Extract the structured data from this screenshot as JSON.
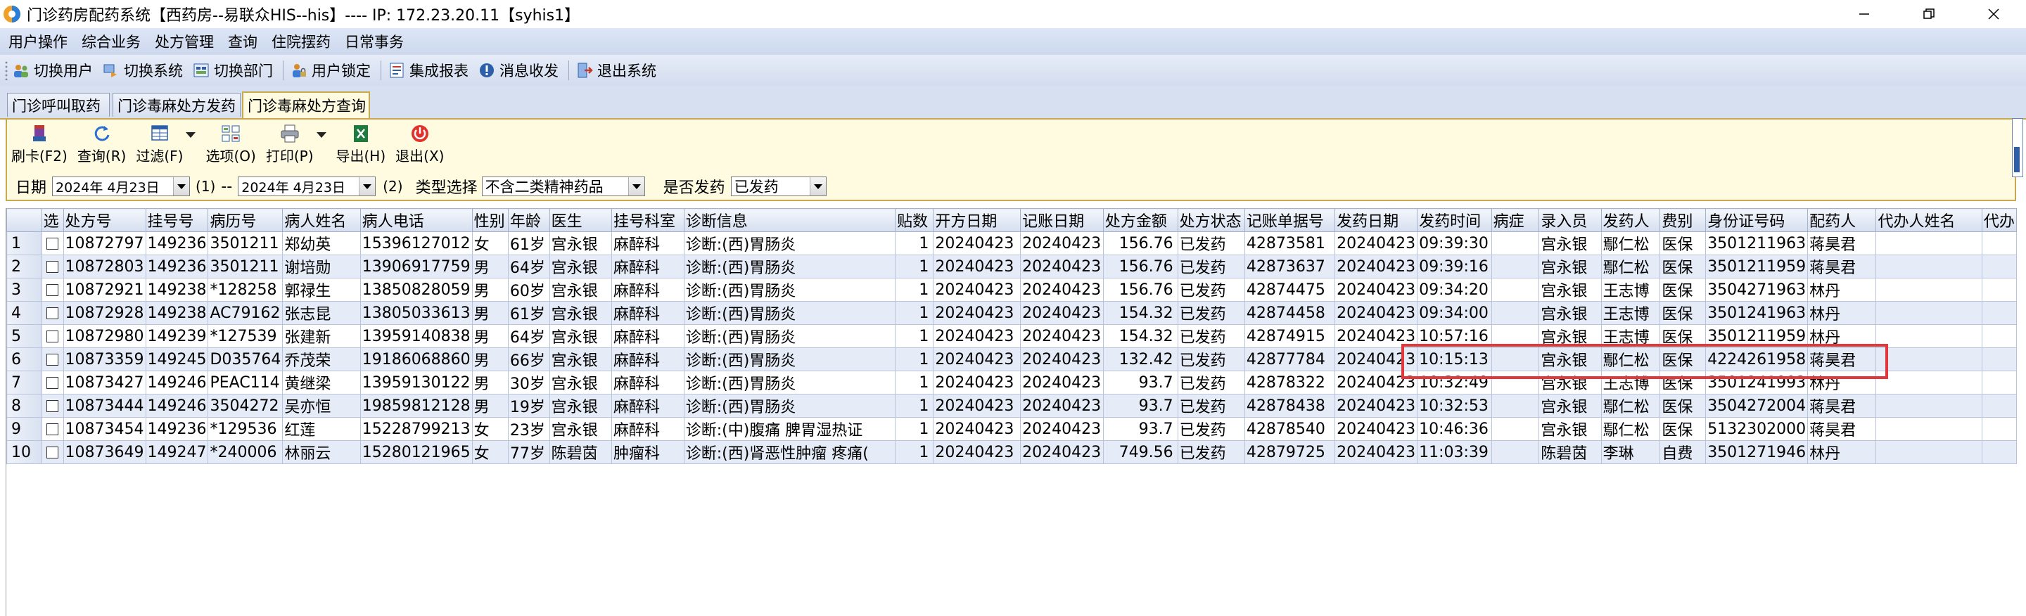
{
  "window": {
    "title": "门诊药房配药系统【西药房--易联众HIS--his】---- IP: 172.23.20.11【syhis1】"
  },
  "menu": [
    "用户操作",
    "综合业务",
    "处方管理",
    "查询",
    "住院摆药",
    "日常事务"
  ],
  "toolbar": {
    "items": [
      {
        "label": "切换用户",
        "icon": "users-icon"
      },
      {
        "label": "切换系统",
        "icon": "switch-system-icon"
      },
      {
        "label": "切换部门",
        "icon": "department-icon"
      },
      {
        "label": "用户锁定",
        "icon": "user-lock-icon"
      },
      {
        "label": "集成报表",
        "icon": "report-icon"
      },
      {
        "label": "消息收发",
        "icon": "message-icon"
      },
      {
        "label": "退出系统",
        "icon": "exit-icon"
      }
    ]
  },
  "tabs": [
    "门诊呼叫取药",
    "门诊毒麻处方发药",
    "门诊毒麻处方查询"
  ],
  "actions": {
    "card": "刷卡(F2)",
    "query": "查询(R)",
    "filter": "过滤(F)",
    "options": "选项(O)",
    "print": "打印(P)",
    "export": "导出(H)",
    "exit": "退出(X)"
  },
  "filter": {
    "date_label": "日期",
    "date_from": "2024年 4月23日",
    "marker1": "(1)",
    "dash": "--",
    "date_to": "2024年 4月23日",
    "marker2": "(2)",
    "type_label": "类型选择",
    "type_value": "不含二类精神药品",
    "dispensed_label": "是否发药",
    "dispensed_value": "已发药"
  },
  "grid": {
    "headers": [
      "",
      "选",
      "处方号",
      "挂号号",
      "病历号",
      "病人姓名",
      "病人电话",
      "性别",
      "年龄",
      "医生",
      "挂号科室",
      "诊断信息",
      "贴数",
      "开方日期",
      "记账日期",
      "处方金额",
      "处方状态",
      "记账单据号",
      "发药日期",
      "发药时间",
      "病症",
      "录入员",
      "发药人",
      "费别",
      "身份证号码",
      "配药人",
      "代办人姓名",
      "代办"
    ],
    "rows": [
      [
        "1",
        "",
        "10872797",
        "149236",
        "3501211",
        "郑幼英",
        "15396127012",
        "女",
        "61岁",
        "宫永银",
        "麻醉科",
        "诊断:(西)胃肠炎",
        "1",
        "20240423",
        "20240423",
        "156.76",
        "已发药",
        "42873581",
        "20240423",
        "09:39:30",
        "",
        "宫永银",
        "鄢仁松",
        "医保",
        "3501211963",
        "蒋昊君",
        "",
        ""
      ],
      [
        "2",
        "",
        "10872803",
        "149236",
        "3501211",
        "谢培勋",
        "13906917759",
        "男",
        "64岁",
        "宫永银",
        "麻醉科",
        "诊断:(西)胃肠炎",
        "1",
        "20240423",
        "20240423",
        "156.76",
        "已发药",
        "42873637",
        "20240423",
        "09:39:16",
        "",
        "宫永银",
        "鄢仁松",
        "医保",
        "3501211959",
        "蒋昊君",
        "",
        ""
      ],
      [
        "3",
        "",
        "10872921",
        "149238",
        "*128258",
        "郭禄生",
        "13850828059",
        "男",
        "60岁",
        "宫永银",
        "麻醉科",
        "诊断:(西)胃肠炎",
        "1",
        "20240423",
        "20240423",
        "156.76",
        "已发药",
        "42874475",
        "20240423",
        "09:34:20",
        "",
        "宫永银",
        "王志博",
        "医保",
        "3504271963",
        "林丹",
        "",
        ""
      ],
      [
        "4",
        "",
        "10872928",
        "149238",
        "AC79162",
        "张志昆",
        "13805033613",
        "男",
        "61岁",
        "宫永银",
        "麻醉科",
        "诊断:(西)胃肠炎",
        "1",
        "20240423",
        "20240423",
        "154.32",
        "已发药",
        "42874458",
        "20240423",
        "09:34:00",
        "",
        "宫永银",
        "王志博",
        "医保",
        "3501241963",
        "林丹",
        "",
        ""
      ],
      [
        "5",
        "",
        "10872980",
        "149239",
        "*127539",
        "张建新",
        "13959140838",
        "男",
        "64岁",
        "宫永银",
        "麻醉科",
        "诊断:(西)胃肠炎",
        "1",
        "20240423",
        "20240423",
        "154.32",
        "已发药",
        "42874915",
        "20240423",
        "10:57:16",
        "",
        "宫永银",
        "王志博",
        "医保",
        "3501211959",
        "林丹",
        "",
        ""
      ],
      [
        "6",
        "",
        "10873359",
        "149245",
        "D035764",
        "乔茂荣",
        "19186068860",
        "男",
        "66岁",
        "宫永银",
        "麻醉科",
        "诊断:(西)胃肠炎",
        "1",
        "20240423",
        "20240423",
        "132.42",
        "已发药",
        "42877784",
        "20240423",
        "10:15:13",
        "",
        "宫永银",
        "鄢仁松",
        "医保",
        "4224261958",
        "蒋昊君",
        "",
        ""
      ],
      [
        "7",
        "",
        "10873427",
        "149246",
        "PEAC114",
        "黄继梁",
        "13959130122",
        "男",
        "30岁",
        "宫永银",
        "麻醉科",
        "诊断:(西)胃肠炎",
        "1",
        "20240423",
        "20240423",
        "93.7",
        "已发药",
        "42878322",
        "20240423",
        "10:32:49",
        "",
        "宫永银",
        "王志博",
        "医保",
        "3501241993",
        "林丹",
        "",
        ""
      ],
      [
        "8",
        "",
        "10873444",
        "149246",
        "3504272",
        "吴亦恒",
        "19859812128",
        "男",
        "19岁",
        "宫永银",
        "麻醉科",
        "诊断:(西)胃肠炎",
        "1",
        "20240423",
        "20240423",
        "93.7",
        "已发药",
        "42878438",
        "20240423",
        "10:32:53",
        "",
        "宫永银",
        "鄢仁松",
        "医保",
        "3504272004",
        "蒋昊君",
        "",
        ""
      ],
      [
        "9",
        "",
        "10873454",
        "149236",
        "*129536",
        "红莲",
        "15228799213",
        "女",
        "23岁",
        "宫永银",
        "麻醉科",
        "诊断:(中)腹痛 脾胃湿热证",
        "1",
        "20240423",
        "20240423",
        "93.7",
        "已发药",
        "42878540",
        "20240423",
        "10:46:36",
        "",
        "宫永银",
        "鄢仁松",
        "医保",
        "5132302000",
        "蒋昊君",
        "",
        ""
      ],
      [
        "10",
        "",
        "10873649",
        "149247",
        "*240006",
        "林丽云",
        "15280121965",
        "女",
        "77岁",
        "陈碧茵",
        "肿瘤科",
        "诊断:(西)肾恶性肿瘤 疼痛(",
        "1",
        "20240423",
        "20240423",
        "749.56",
        "已发药",
        "42879725",
        "20240423",
        "11:03:39",
        "",
        "陈碧茵",
        "李琳",
        "自费",
        "3501271946",
        "林丹",
        "",
        ""
      ]
    ]
  },
  "colors": {
    "accent_border": "#c9a94f",
    "panel_bg": "#fffbe0",
    "highlight": "#e0383d",
    "row_alt": "#e5ecf8"
  }
}
